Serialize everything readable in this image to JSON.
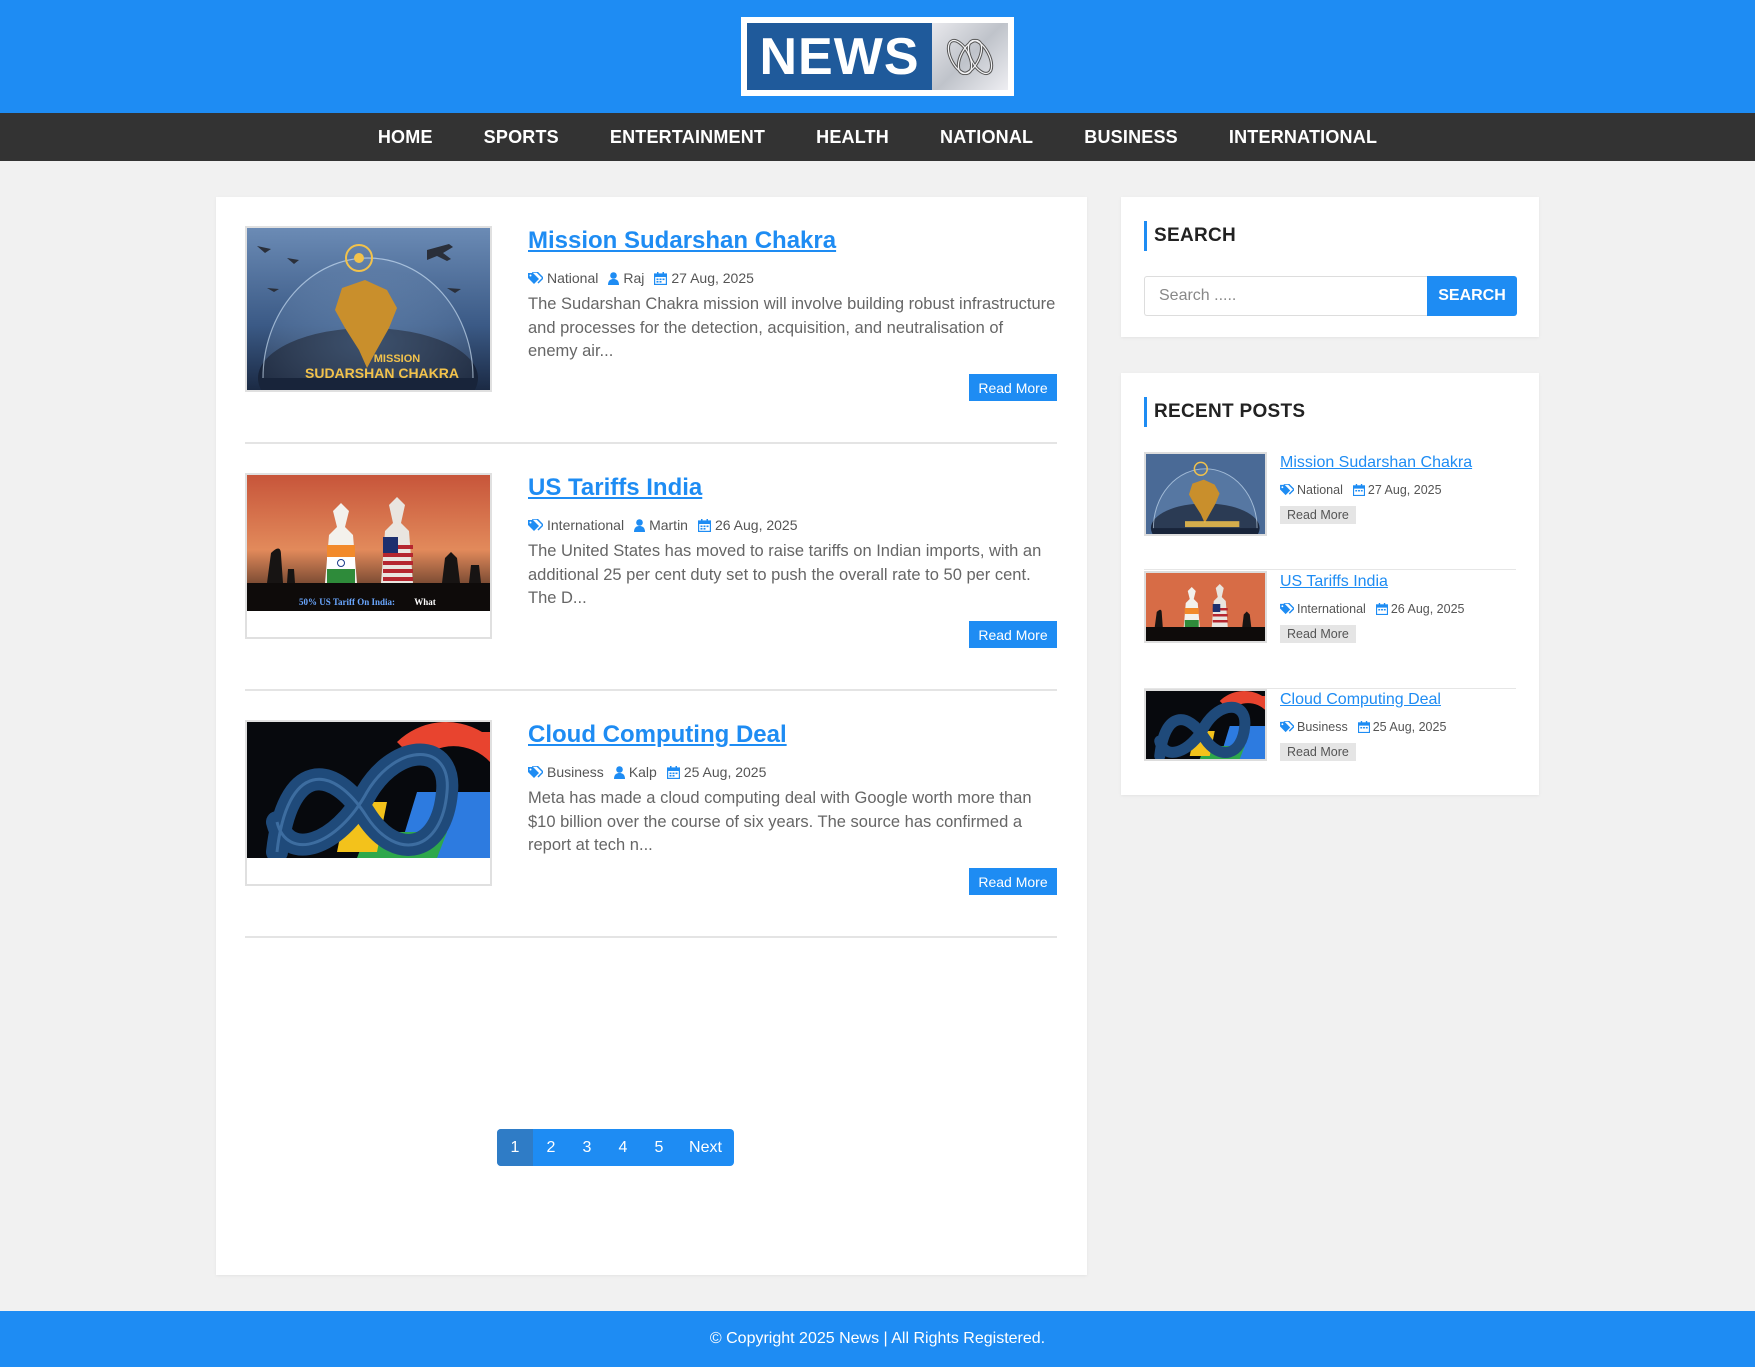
{
  "site": {
    "logo_text": "NEWS",
    "brand_color": "#1e8cf3",
    "nav_bg": "#333333"
  },
  "nav": {
    "items": [
      {
        "label": "HOME"
      },
      {
        "label": "SPORTS"
      },
      {
        "label": "ENTERTAINMENT"
      },
      {
        "label": "HEALTH"
      },
      {
        "label": "NATIONAL"
      },
      {
        "label": "BUSINESS"
      },
      {
        "label": "INTERNATIONAL"
      }
    ]
  },
  "posts": [
    {
      "title": "Mission Sudarshan Chakra",
      "category": "National",
      "author": "Raj",
      "date": "27 Aug, 2025",
      "excerpt": "The Sudarshan Chakra mission will involve building robust infrastructure and processes for the detection, acquisition, and neutralisation of enemy air...",
      "read_more": "Read More",
      "image_caption_1": "MISSION",
      "image_caption_2": "SUDARSHAN CHAKRA"
    },
    {
      "title": "US Tariffs India",
      "category": "International",
      "author": "Martin",
      "date": "26 Aug, 2025",
      "excerpt": "The United States has moved to raise tariffs on Indian imports, with an additional 25 per cent duty set to push the overall rate to 50 per cent. The D...",
      "read_more": "Read More",
      "image_caption_1": "50% US Tariff On India:",
      "image_caption_2": "What"
    },
    {
      "title": "Cloud Computing Deal",
      "category": "Business",
      "author": "Kalp",
      "date": "25 Aug, 2025",
      "excerpt": "Meta has made a cloud computing deal with Google worth more than $10 billion over the course of six years. The source has confirmed a report at tech n...",
      "read_more": "Read More"
    }
  ],
  "pagination": {
    "pages": [
      "1",
      "2",
      "3",
      "4",
      "5"
    ],
    "active": 1,
    "next_label": "Next"
  },
  "sidebar": {
    "search": {
      "title": "SEARCH",
      "placeholder": "Search .....",
      "button": "SEARCH"
    },
    "recent": {
      "title": "RECENT POSTS",
      "items": [
        {
          "title": "Mission Sudarshan Chakra",
          "category": "National",
          "date": "27 Aug, 2025",
          "read_more": "Read More"
        },
        {
          "title": "US Tariffs India",
          "category": "International",
          "date": "26 Aug, 2025",
          "read_more": "Read More"
        },
        {
          "title": "Cloud Computing Deal",
          "category": "Business",
          "date": "25 Aug, 2025",
          "read_more": "Read More"
        }
      ]
    }
  },
  "footer": {
    "text": "© Copyright 2025 News | All Rights Registered."
  },
  "icons": {
    "category": "tag-icon",
    "author": "user-icon",
    "date": "calendar-icon"
  }
}
